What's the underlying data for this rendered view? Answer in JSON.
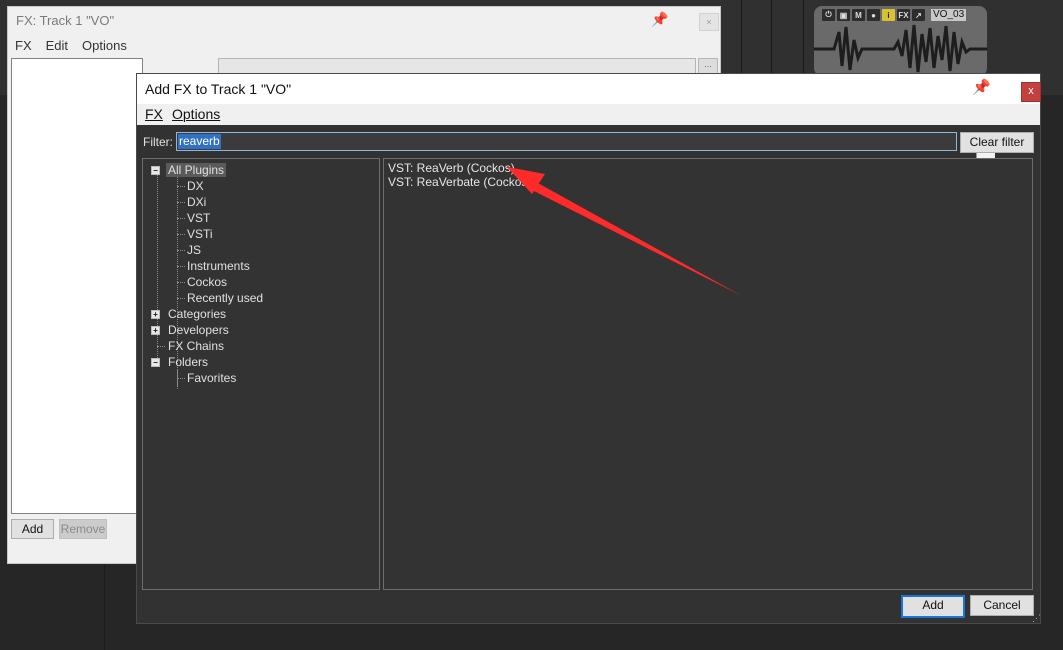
{
  "background": {
    "track_item": {
      "name": "VO_03",
      "icons": [
        "power-icon",
        "lock-icon",
        "mute-icon",
        "comment-icon",
        "info-icon",
        "fx-icon",
        "envelope-icon"
      ],
      "icon_labels": [
        "",
        "",
        "M",
        "",
        "i",
        "FX",
        ""
      ]
    }
  },
  "fx_window": {
    "title": "FX: Track 1 \"VO\"",
    "menu": [
      "FX",
      "Edit",
      "Options"
    ],
    "add_label": "Add",
    "remove_label": "Remove",
    "more_label": "..."
  },
  "dialog": {
    "title": "Add FX to Track 1 \"VO\"",
    "close_label": "x",
    "menu": [
      "FX",
      "Options"
    ],
    "filter_label": "Filter:",
    "filter_value": "reaverb",
    "clear_filter_label": "Clear filter",
    "tree": [
      {
        "label": "All Plugins",
        "level": 0,
        "expander": "minus",
        "selected": true
      },
      {
        "label": "DX",
        "level": 1
      },
      {
        "label": "DXi",
        "level": 1
      },
      {
        "label": "VST",
        "level": 1
      },
      {
        "label": "VSTi",
        "level": 1
      },
      {
        "label": "JS",
        "level": 1
      },
      {
        "label": "Instruments",
        "level": 1
      },
      {
        "label": "Cockos",
        "level": 1
      },
      {
        "label": "Recently used",
        "level": 1
      },
      {
        "label": "Categories",
        "level": 0,
        "expander": "plus"
      },
      {
        "label": "Developers",
        "level": 0,
        "expander": "plus"
      },
      {
        "label": "FX Chains",
        "level": 0,
        "expander": "none"
      },
      {
        "label": "Folders",
        "level": 0,
        "expander": "minus"
      },
      {
        "label": "Favorites",
        "level": 1
      }
    ],
    "results": [
      "VST: ReaVerb (Cockos)",
      "VST: ReaVerbate (Cockos)"
    ],
    "add_label": "Add",
    "cancel_label": "Cancel"
  },
  "colors": {
    "annotation_arrow": "#ff2a2a",
    "filter_selection": "#3071c4",
    "close_button": "#c4403f"
  }
}
